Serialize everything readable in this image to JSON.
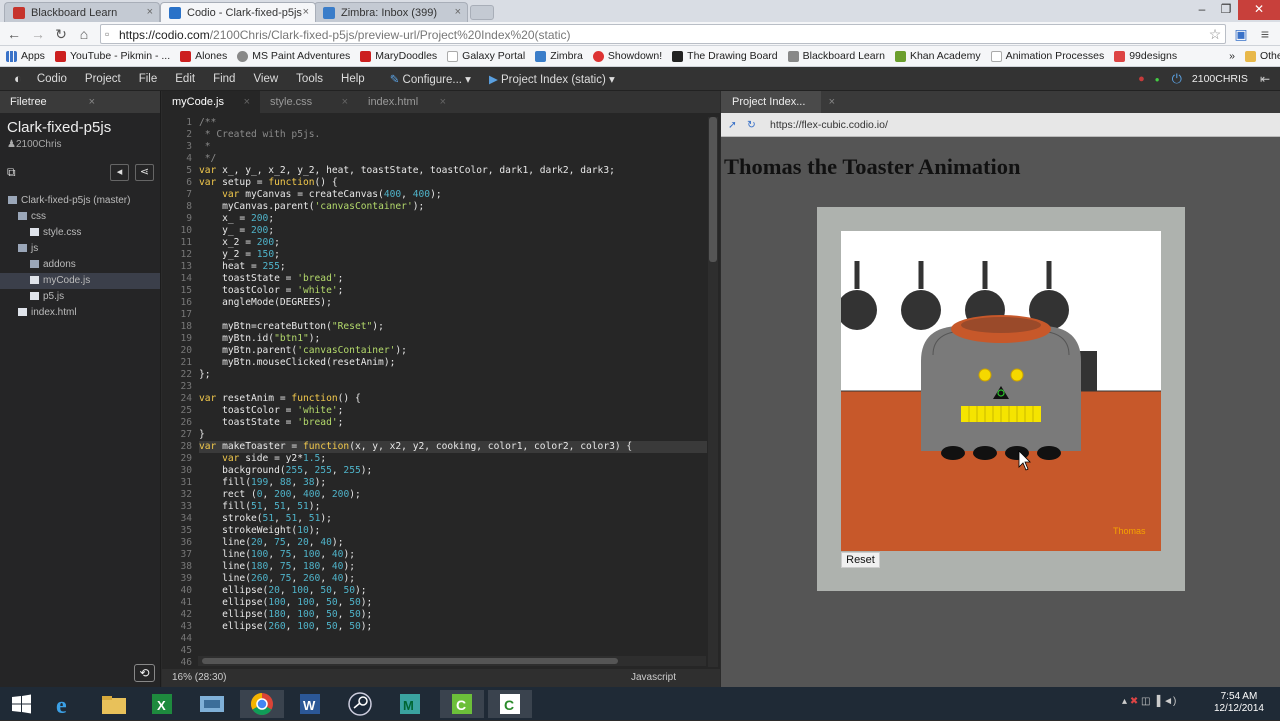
{
  "browser": {
    "tabs": [
      {
        "title": "Blackboard Learn",
        "color": "#c6342c"
      },
      {
        "title": "Codio - Clark-fixed-p5js",
        "color": "#2a72c8"
      },
      {
        "title": "Zimbra: Inbox (399)",
        "color": "#3a7dc9"
      }
    ],
    "url_host": "https://codio.com",
    "url_path": "/2100Chris/Clark-fixed-p5js/preview-url/Project%20Index%20(static)",
    "bookmarks": [
      "Apps",
      "YouTube - Pikmin - ...",
      "Alones",
      "MS Paint Adventures",
      "MaryDoodles",
      "Galaxy Portal",
      "Zimbra",
      "Showdown!",
      "The Drawing Board",
      "Blackboard Learn",
      "Khan Academy",
      "Animation Processes",
      "99designs",
      "»",
      "Other bookmarks"
    ]
  },
  "codio": {
    "menus": [
      "Codio",
      "Project",
      "File",
      "Edit",
      "Find",
      "View",
      "Tools",
      "Help"
    ],
    "configure": "Configure...",
    "project_index": "Project Index (static)",
    "username": "2100CHRIS"
  },
  "filetree": {
    "tab": "Filetree",
    "project_name": "Clark-fixed-p5js",
    "user": "2100Chris",
    "items": [
      {
        "label": "Clark-fixed-p5js (master)",
        "indent": 0,
        "type": "folder"
      },
      {
        "label": "css",
        "indent": 1,
        "type": "folder"
      },
      {
        "label": "style.css",
        "indent": 2,
        "type": "file"
      },
      {
        "label": "js",
        "indent": 1,
        "type": "folder"
      },
      {
        "label": "addons",
        "indent": 2,
        "type": "folder"
      },
      {
        "label": "myCode.js",
        "indent": 2,
        "type": "file",
        "selected": true
      },
      {
        "label": "p5.js",
        "indent": 2,
        "type": "file"
      },
      {
        "label": "index.html",
        "indent": 1,
        "type": "file"
      }
    ]
  },
  "editor": {
    "tabs": [
      "myCode.js",
      "style.css",
      "index.html"
    ],
    "status_left": "16%  (28:30)",
    "status_mode": "Javascript",
    "lines": [
      "/**",
      " * Created with p5js.",
      " *",
      " */",
      "var x_, y_, x_2, y_2, heat, toastState, toastColor, dark1, dark2, dark3;",
      "var setup = function() {",
      "    var myCanvas = createCanvas(400, 400);",
      "    myCanvas.parent('canvasContainer');",
      "    x_ = 200;",
      "    y_ = 200;",
      "    x_2 = 200;",
      "    y_2 = 150;",
      "    heat = 255;",
      "    toastState = 'bread';",
      "    toastColor = 'white';",
      "    angleMode(DEGREES);",
      "",
      "    myBtn=createButton(\"Reset\");",
      "    myBtn.id(\"btn1\");",
      "    myBtn.parent('canvasContainer');",
      "    myBtn.mouseClicked(resetAnim);",
      "};",
      "",
      "var resetAnim = function() {",
      "    toastColor = 'white';",
      "    toastState = 'bread';",
      "}",
      "var makeToaster = function(x, y, x2, y2, cooking, color1, color2, color3) {",
      "    var side = y2*1.5;",
      "    background(255, 255, 255);",
      "    fill(199, 88, 38);",
      "    rect (0, 200, 400, 200);",
      "    fill(51, 51, 51);",
      "    stroke(51, 51, 51);",
      "    strokeWeight(10);",
      "    line(20, 75, 20, 40);",
      "    line(100, 75, 100, 40);",
      "    line(180, 75, 180, 40);",
      "    line(260, 75, 260, 40);",
      "    ellipse(20, 100, 50, 50);",
      "    ellipse(100, 100, 50, 50);",
      "    ellipse(180, 100, 50, 50);",
      "    ellipse(260, 100, 50, 50);",
      "",
      "",
      ""
    ]
  },
  "preview": {
    "tab": "Project Index...",
    "url": "https://flex-cubic.codio.io/",
    "page_title": "Thomas the Toaster Animation",
    "canvas_label": "Thomas",
    "reset_label": "Reset"
  },
  "taskbar": {
    "time": "7:54 AM",
    "date": "12/12/2014"
  }
}
